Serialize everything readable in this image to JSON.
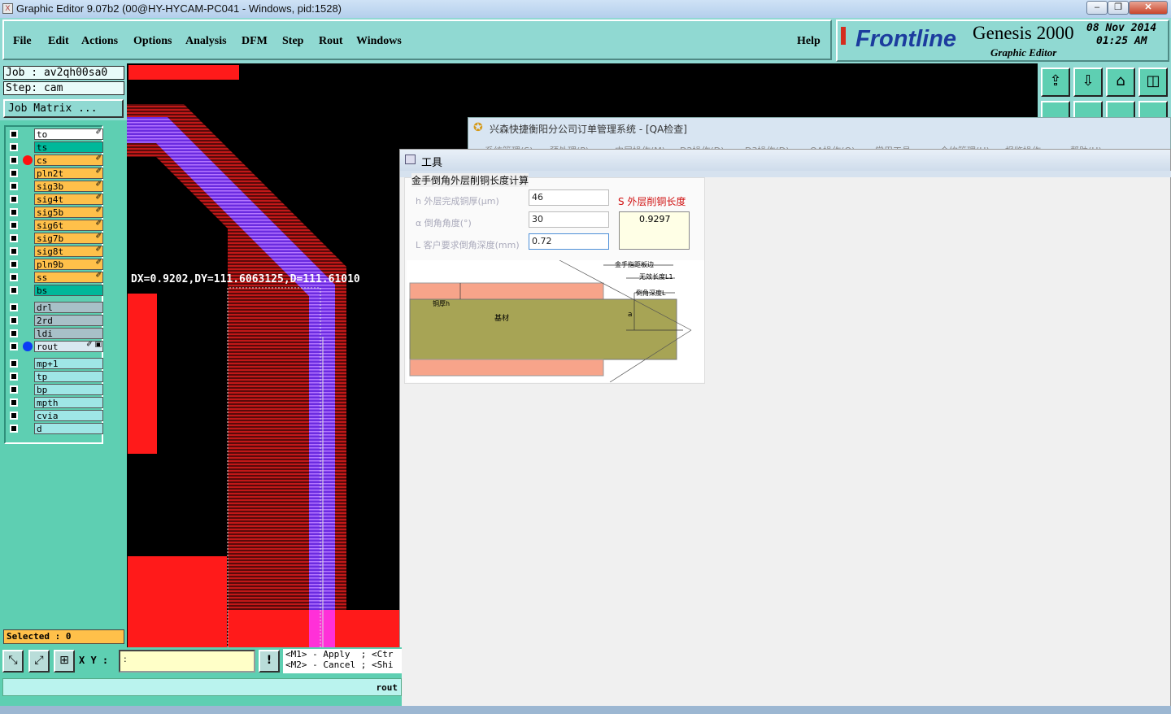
{
  "window": {
    "title": "Graphic Editor 9.07b2 (00@HY-HYCAM-PC041 - Windows, pid:1528)"
  },
  "menu": {
    "items": [
      "File",
      "Edit",
      "Actions",
      "Options",
      "Analysis",
      "DFM",
      "Step",
      "Rout",
      "Windows"
    ],
    "help": "Help"
  },
  "brand": {
    "logo": "Frontline",
    "product": "Genesis 2000",
    "subtitle": "Graphic Editor",
    "date": "08 Nov 2014",
    "time": "01:25 AM"
  },
  "job": {
    "job_label": "Job : av2qh00sa0",
    "step_label": "Step: cam",
    "matrix_button": "Job Matrix ..."
  },
  "layers": [
    {
      "name": "to",
      "color": "#ffffff",
      "dot": "",
      "edit": "✐"
    },
    {
      "name": "ts",
      "color": "#00b89a",
      "dot": "",
      "edit": ""
    },
    {
      "name": "cs",
      "color": "#ffc04a",
      "dot": "#ff1010",
      "edit": "✐"
    },
    {
      "name": "pln2t",
      "color": "#ffc04a",
      "dot": "",
      "edit": "✐"
    },
    {
      "name": "sig3b",
      "color": "#ffc04a",
      "dot": "",
      "edit": "✐"
    },
    {
      "name": "sig4t",
      "color": "#ffc04a",
      "dot": "",
      "edit": "✐"
    },
    {
      "name": "sig5b",
      "color": "#ffc04a",
      "dot": "",
      "edit": "✐"
    },
    {
      "name": "sig6t",
      "color": "#ffc04a",
      "dot": "",
      "edit": "✐"
    },
    {
      "name": "sig7b",
      "color": "#ffc04a",
      "dot": "",
      "edit": "✐"
    },
    {
      "name": "sig8t",
      "color": "#ffc04a",
      "dot": "",
      "edit": "✐"
    },
    {
      "name": "pln9b",
      "color": "#ffc04a",
      "dot": "",
      "edit": "✐"
    },
    {
      "name": "ss",
      "color": "#ffc04a",
      "dot": "",
      "edit": "✐"
    },
    {
      "name": "bs",
      "color": "#00b89a",
      "dot": "",
      "edit": ""
    },
    {
      "name": "drl",
      "color": "#a8c0c8",
      "dot": "",
      "edit": ""
    },
    {
      "name": "2rd",
      "color": "#a8c0c8",
      "dot": "",
      "edit": ""
    },
    {
      "name": "ldi",
      "color": "#a8c0c8",
      "dot": "",
      "edit": ""
    },
    {
      "name": "rout",
      "color": "#d8e8f0",
      "dot": "#0b3cf5",
      "edit": "✐ ▣"
    },
    {
      "name": "mp+1",
      "color": "#9fe6e6",
      "dot": "",
      "edit": ""
    },
    {
      "name": "tp",
      "color": "#9fe6e6",
      "dot": "",
      "edit": ""
    },
    {
      "name": "bp",
      "color": "#9fe6e6",
      "dot": "",
      "edit": ""
    },
    {
      "name": "mpth",
      "color": "#9fe6e6",
      "dot": "",
      "edit": ""
    },
    {
      "name": "cvia",
      "color": "#9fe6e6",
      "dot": "",
      "edit": ""
    },
    {
      "name": "d",
      "color": "#9fe6e6",
      "dot": "",
      "edit": ""
    }
  ],
  "status": {
    "selected": "Selected : 0",
    "measure": "DX=0.9202,DY=111.6063125,D=111.61010",
    "xy_label": "X Y :",
    "xy_value": ":",
    "hint1": "<M1> - Apply  ; <Ctr",
    "hint2": "<M2> - Cancel ; <Shi",
    "bottom_text": "rout"
  },
  "qa_window": {
    "title": "兴森快捷衡阳分公司订单管理系统 - [QA检查]",
    "menus": [
      "系统管理(S)",
      "预处理(P)",
      "内层操作(M)",
      "D2操作(D)",
      "D3操作(D)",
      "QA操作(Q)",
      "常用工具",
      "合约管理(H)",
      "报鉴操作",
      "帮助(H)"
    ]
  },
  "tool_window": {
    "title": "工具",
    "group": "金手倒角外层削铜长度计算",
    "fields": [
      {
        "label": "h 外层完成铜厚(μm)",
        "value": "46"
      },
      {
        "label": "α 倒角角度(°)",
        "value": "30"
      },
      {
        "label": "L 客户要求倒角深度(mm)",
        "value": "0.72"
      }
    ],
    "result_label": "S 外层削铜长度",
    "result_value": "0.9297",
    "diagram": {
      "l1": "金手指距板边",
      "l2": "无效长度L1",
      "l3": "倒角深度L",
      "l4": "铜厚h",
      "l5": "基材",
      "l6": "a"
    }
  }
}
